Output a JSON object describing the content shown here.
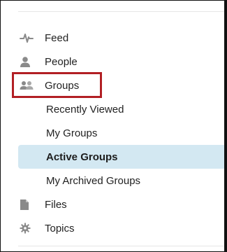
{
  "nav": {
    "feed": "Feed",
    "people": "People",
    "groups": "Groups",
    "recently_viewed": "Recently Viewed",
    "my_groups": "My Groups",
    "active_groups": "Active Groups",
    "my_archived_groups": "My Archived Groups",
    "files": "Files",
    "topics": "Topics"
  },
  "colors": {
    "active_background": "#d3e8f2",
    "highlight_border": "#b21f24",
    "icon": "#8a8a8a"
  },
  "icons": {
    "feed": "pulse-icon",
    "people": "person-icon",
    "groups": "people-group-icon",
    "files": "document-icon",
    "topics": "gear-icon"
  }
}
